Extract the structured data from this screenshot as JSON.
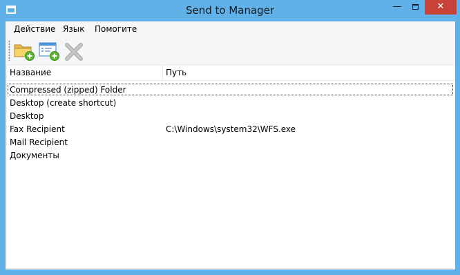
{
  "window": {
    "title": "Send to Manager",
    "minimize_glyph": "—",
    "close_glyph": "✕"
  },
  "menu": {
    "items": [
      {
        "label": "Действие"
      },
      {
        "label": "Язык"
      },
      {
        "label": "Помогите"
      }
    ]
  },
  "toolbar": {
    "buttons": [
      {
        "icon": "folder-add-icon",
        "enabled": true
      },
      {
        "icon": "window-add-icon",
        "enabled": true
      },
      {
        "icon": "delete-x-icon",
        "enabled": false
      }
    ]
  },
  "list": {
    "columns": [
      "Название",
      "Путь"
    ],
    "rows": [
      {
        "name": "Compressed (zipped) Folder",
        "path": ""
      },
      {
        "name": "Desktop (create shortcut)",
        "path": ""
      },
      {
        "name": "Desktop",
        "path": ""
      },
      {
        "name": "Fax Recipient",
        "path": "C:\\Windows\\system32\\WFS.exe"
      },
      {
        "name": "Mail Recipient",
        "path": ""
      },
      {
        "name": "Документы",
        "path": ""
      }
    ],
    "focused_row_index": 0
  },
  "colors": {
    "frame": "#5fb1e8",
    "close_button": "#c7433a",
    "client": "#f0f0f0"
  }
}
